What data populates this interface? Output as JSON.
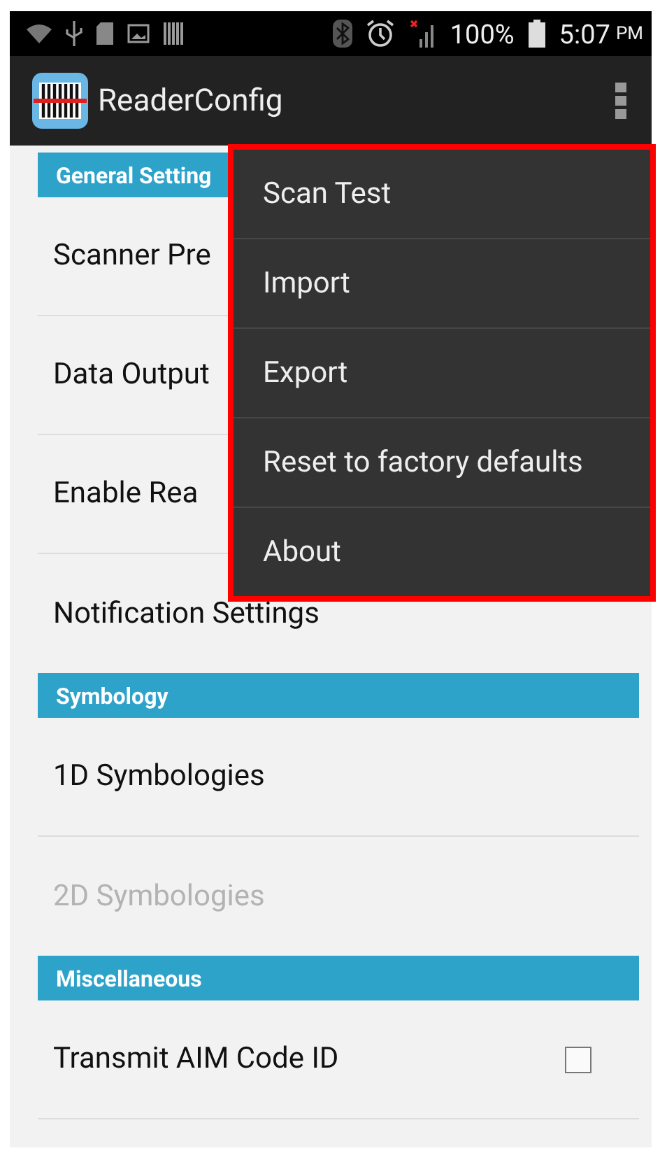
{
  "status_bar": {
    "battery_text": "100%",
    "time": "5:07",
    "ampm": "PM"
  },
  "app_bar": {
    "title": "ReaderConfig"
  },
  "list": [
    {
      "kind": "header",
      "label": "General Setting"
    },
    {
      "kind": "item",
      "label": "Scanner Pre",
      "disabled": false
    },
    {
      "kind": "item",
      "label": "Data Output",
      "disabled": false
    },
    {
      "kind": "item",
      "label": "Enable Rea",
      "disabled": false
    },
    {
      "kind": "item",
      "label": "Notification Settings",
      "disabled": false
    },
    {
      "kind": "header",
      "label": "Symbology"
    },
    {
      "kind": "item",
      "label": "1D Symbologies",
      "disabled": false
    },
    {
      "kind": "item",
      "label": "2D Symbologies",
      "disabled": true
    },
    {
      "kind": "header",
      "label": "Miscellaneous"
    },
    {
      "kind": "checkbox",
      "label": "Transmit AIM Code ID",
      "checked": false
    }
  ],
  "menu": {
    "items": [
      "Scan Test",
      "Import",
      "Export",
      "Reset to factory defaults",
      "About"
    ]
  }
}
